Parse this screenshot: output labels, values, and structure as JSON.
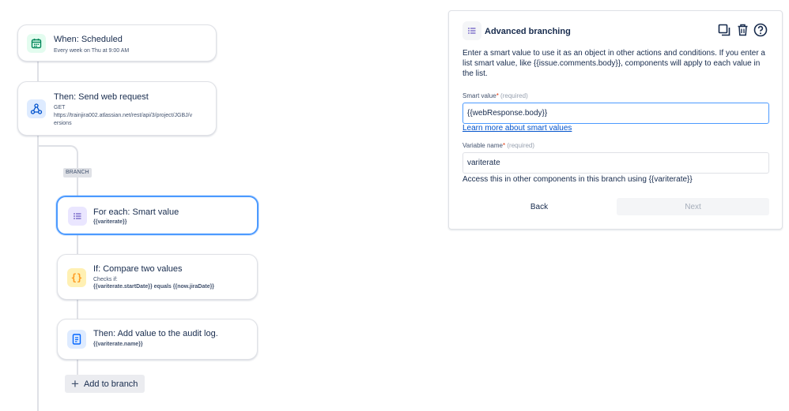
{
  "colors": {
    "accent": "#0052cc",
    "selected_border": "#4c9aff",
    "schedule_icon": "#00875a",
    "web_icon": "#0052cc",
    "branch_icon": "#6554c0",
    "condition_icon": "#ff991f",
    "action_icon": "#0065ff"
  },
  "flow": {
    "trigger": {
      "title": "When: Scheduled",
      "subtitle": "Every week on Thu at 9:00 AM",
      "icon": "calendar-icon"
    },
    "web_request": {
      "title": "Then: Send web request",
      "method": "GET",
      "url_line1": "https://trainjira002.atlassian.net/rest/api/3/project/JGBJ/v",
      "url_line2": "ersions",
      "icon": "webhook-icon"
    },
    "branch_tag": "BRANCH",
    "for_each": {
      "title": "For each: Smart value",
      "value": "{{variterate}}",
      "icon": "list-icon"
    },
    "condition": {
      "title": "If: Compare two values",
      "checks_label": "Checks if:",
      "expression": "{{variterate.startDate}} equals {{now.jiraDate}}",
      "icon": "braces-icon"
    },
    "audit": {
      "title": "Then: Add value to the audit log.",
      "value": "{{variterate.name}}",
      "icon": "document-icon"
    },
    "add_branch_label": "Add to branch"
  },
  "panel": {
    "title": "Advanced branching",
    "description": "Enter a smart value to use it as an object in other actions and conditions. If you enter a list smart value, like {{issue.comments.body}}, components will apply to each value in the list.",
    "smart_value": {
      "label": "Smart value",
      "required_mark": "*",
      "hint": "(required)",
      "value": "{{webResponse.body}}"
    },
    "learn_more_link": "Learn more about smart values",
    "variable_name": {
      "label": "Variable name",
      "required_mark": "*",
      "hint": "(required)",
      "value": "variterate"
    },
    "helper_text": "Access this in other components in this branch using {{variterate}}",
    "back_label": "Back",
    "next_label": "Next",
    "header_icons": [
      "duplicate-icon",
      "trash-icon",
      "help-icon"
    ]
  }
}
